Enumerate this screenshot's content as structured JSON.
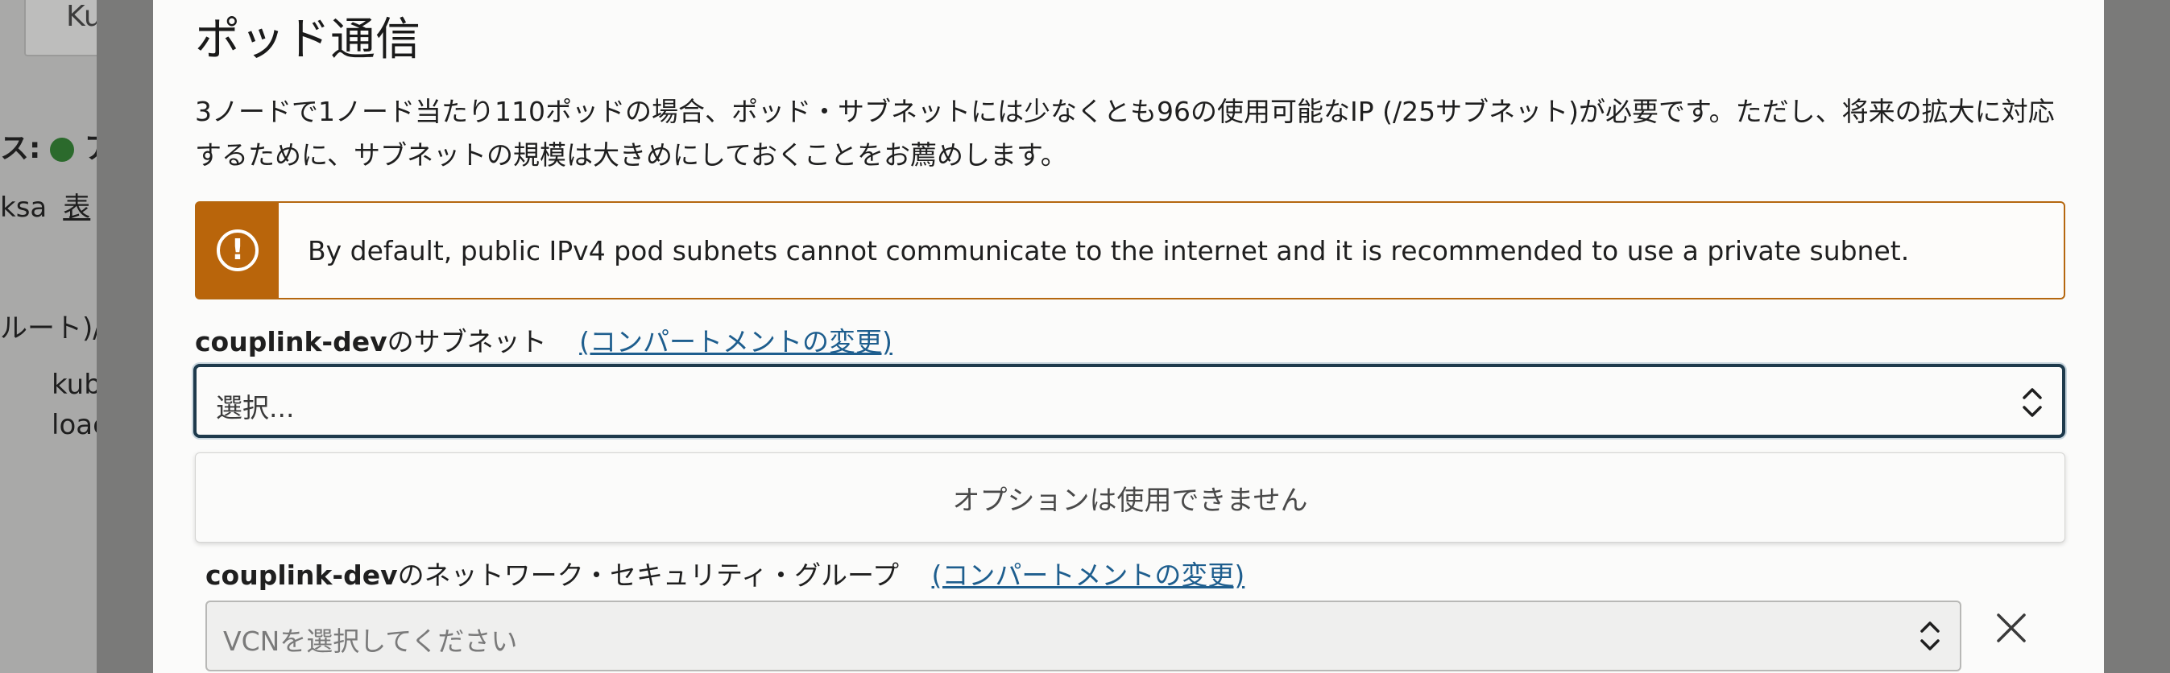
{
  "background": {
    "button_text": "Ku",
    "status_label": "ス:",
    "status_text": "ア",
    "line1_prefix": "ksa",
    "line1_link": "表",
    "line2": "ルート)/",
    "line3": "kub",
    "line4": "loac"
  },
  "panel": {
    "title": "ポッド通信",
    "description": "3ノードで1ノード当たり110ポッドの場合、ポッド・サブネットには少なくとも96の使用可能なIP (/25サブネット)が必要です。ただし、将来の拡大に対応するために、サブネットの規模は大きめにしておくことをお薦めします。",
    "warning": "By default, public IPv4 pod subnets cannot communicate to the internet and it is recommended to use a private subnet.",
    "subnet_label_bold": "couplink-dev",
    "subnet_label_rest": "のサブネット",
    "change_compartment_1": "(コンパートメントの変更)",
    "subnet_select_value": "選択...",
    "dropdown_empty": "オプションは使用できません",
    "nsg_label_bold": "couplink-dev",
    "nsg_label_rest": "のネットワーク・セキュリティ・グループ",
    "change_compartment_2": "(コンパートメントの変更)",
    "nsg_select_placeholder": "VCNを選択してください"
  },
  "colors": {
    "warning_accent": "#b9650b",
    "link": "#1e5e8e",
    "focus_border": "#1e3a4c"
  }
}
